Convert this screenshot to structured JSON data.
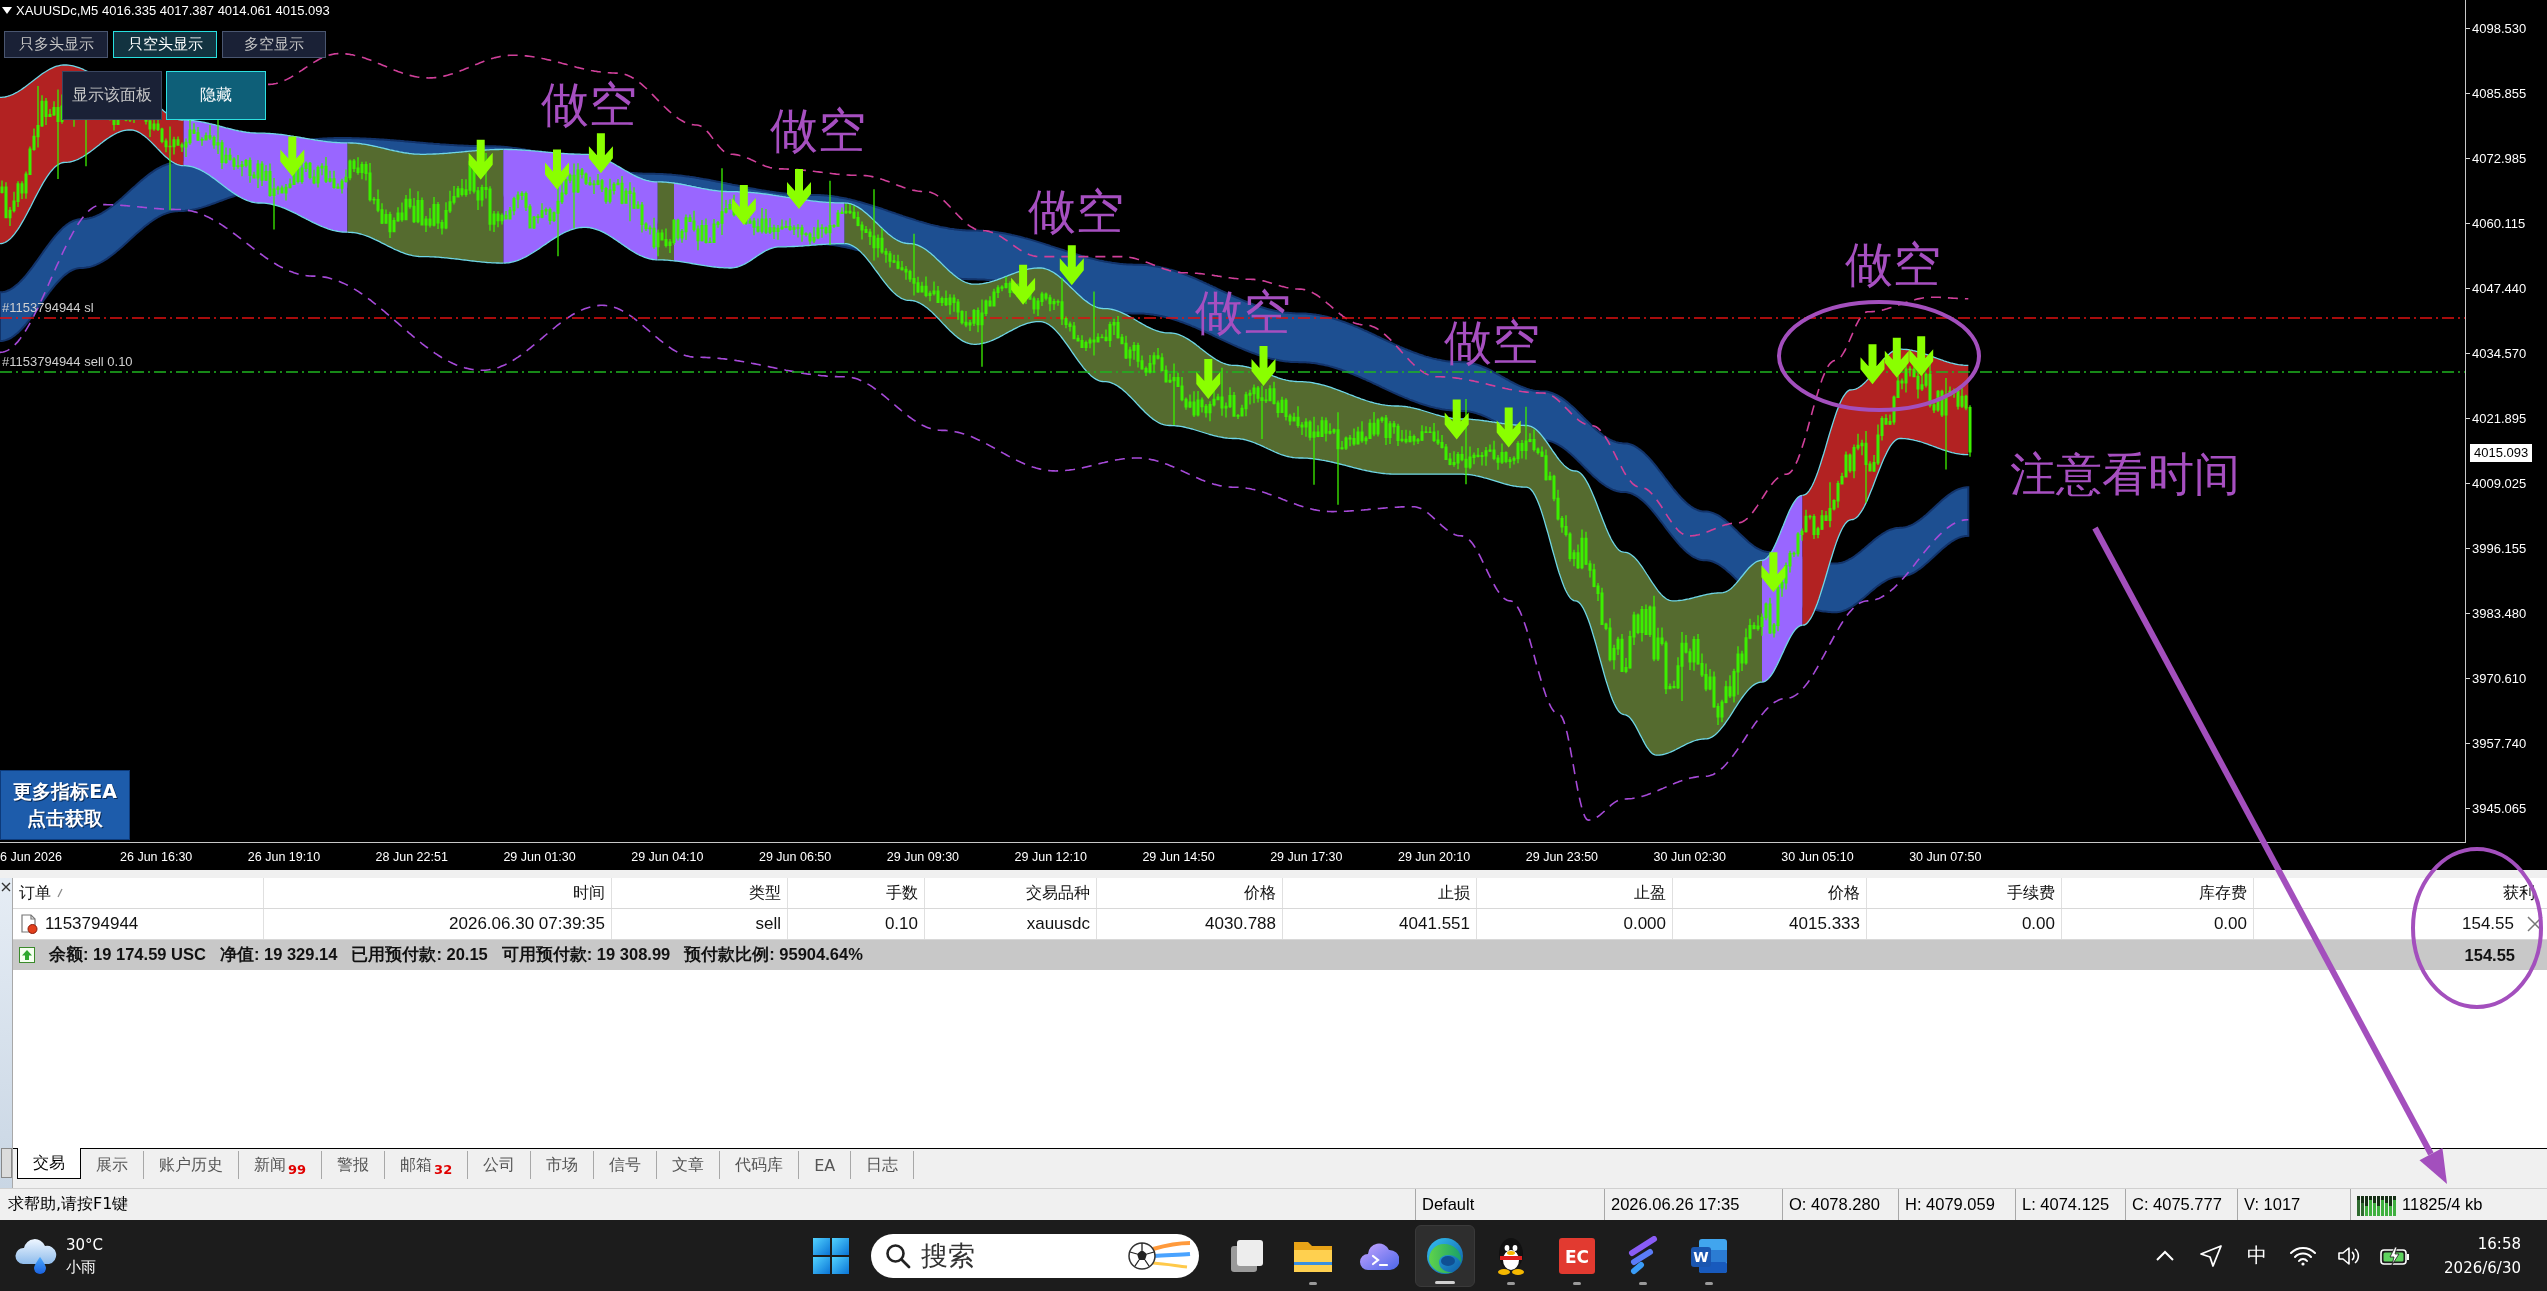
{
  "chart": {
    "title": "XAUUSDc,M5 4016.335 4017.387 4014.061 4015.093",
    "mode_buttons": [
      {
        "label": "只多头显示",
        "selected": false
      },
      {
        "label": "只空头显示",
        "selected": true
      },
      {
        "label": "多空显示",
        "selected": false
      }
    ],
    "panel_buttons": [
      {
        "label": "显示该面板",
        "selected": false
      },
      {
        "label": "隐藏",
        "selected": true
      }
    ],
    "trade_lines": [
      {
        "kind": "stop_loss",
        "label": "#1153794944 sl"
      },
      {
        "kind": "order",
        "label": "#1153794944 sell 0.10"
      }
    ],
    "signal_labels": [
      "做空",
      "做空",
      "做空",
      "做空",
      "做空",
      "做空"
    ],
    "note": "注意看时间",
    "promo_button": {
      "lines": [
        "更多指标EA",
        "点击获取"
      ]
    },
    "price_axis": {
      "labels": [
        "4098.530",
        "4085.855",
        "4072.985",
        "4060.115",
        "4047.440",
        "4034.570",
        "4021.895",
        "4009.025",
        "3996.155",
        "3983.480",
        "3970.610",
        "3957.740",
        "3945.065"
      ],
      "current_price": "4015.093"
    },
    "time_axis": {
      "labels": [
        "6 Jun 2026",
        "26 Jun 16:30",
        "26 Jun 19:10",
        "28 Jun 22:51",
        "29 Jun 01:30",
        "29 Jun 04:10",
        "29 Jun 06:50",
        "29 Jun 09:30",
        "29 Jun 12:10",
        "29 Jun 14:50",
        "29 Jun 17:30",
        "29 Jun 20:10",
        "29 Jun 23:50",
        "30 Jun 02:30",
        "30 Jun 05:10",
        "30 Jun 07:50"
      ]
    }
  },
  "terminal": {
    "columns": [
      {
        "label": "订单",
        "sorted": true
      },
      {
        "label": "时间",
        "sorted": false
      },
      {
        "label": "类型",
        "sorted": false
      },
      {
        "label": "手数",
        "sorted": false
      },
      {
        "label": "交易品种",
        "sorted": false
      },
      {
        "label": "价格",
        "sorted": false
      },
      {
        "label": "止损",
        "sorted": false
      },
      {
        "label": "止盈",
        "sorted": false
      },
      {
        "label": "价格",
        "sorted": false
      },
      {
        "label": "手续费",
        "sorted": false
      },
      {
        "label": "库存费",
        "sorted": false
      },
      {
        "label": "获利",
        "sorted": false
      }
    ],
    "rows": [
      {
        "cells": [
          "1153794944",
          "2026.06.30 07:39:35",
          "sell",
          "0.10",
          "xauusdc",
          "4030.788",
          "4041.551",
          "0.000",
          "4015.333",
          "0.00",
          "0.00",
          "154.55"
        ]
      }
    ],
    "summary": {
      "items": [
        "余额: 19 174.59 USC",
        "净值: 19 329.14",
        "已用预付款: 20.15",
        "可用预付款: 19 308.99",
        "预付款比例: 95904.64%"
      ],
      "profit": "154.55"
    },
    "tabs": [
      {
        "label": "交易",
        "selected": true
      },
      {
        "label": "展示",
        "selected": false
      },
      {
        "label": "账户历史",
        "selected": false
      },
      {
        "label": "新闻",
        "badge": "99",
        "selected": false
      },
      {
        "label": "警报",
        "selected": false
      },
      {
        "label": "邮箱",
        "badge": "32",
        "selected": false
      },
      {
        "label": "公司",
        "selected": false
      },
      {
        "label": "市场",
        "selected": false
      },
      {
        "label": "信号",
        "selected": false
      },
      {
        "label": "文章",
        "selected": false
      },
      {
        "label": "代码库",
        "selected": false
      },
      {
        "label": "EA",
        "selected": false
      },
      {
        "label": "日志",
        "selected": false
      }
    ]
  },
  "status_bar": {
    "help": "求帮助,请按F1键",
    "fields": [
      "Default",
      "2026.06.26 17:35",
      "O: 4078.280",
      "H: 4079.059",
      "L: 4074.125",
      "C: 4075.777",
      "V: 1017"
    ],
    "traffic": "11825/4 kb"
  },
  "taskbar": {
    "weather": {
      "temperature": "30°C",
      "condition": "小雨"
    },
    "search": {
      "placeholder": "搜索"
    },
    "apps": [
      {
        "kind": "window",
        "running": false,
        "selected": false
      },
      {
        "kind": "folder",
        "running": true,
        "selected": false
      },
      {
        "kind": "cloud",
        "running": false,
        "selected": false
      },
      {
        "kind": "browser",
        "running": true,
        "selected": true
      },
      {
        "kind": "penguin",
        "running": true,
        "selected": false
      },
      {
        "kind": "tile",
        "text": "EC",
        "running": true,
        "selected": false
      },
      {
        "kind": "feather",
        "running": true,
        "selected": false
      },
      {
        "kind": "document",
        "text": "W",
        "running": true,
        "selected": false
      }
    ],
    "input_method": "中",
    "clock": {
      "time": "16:58",
      "date": "2026/6/30"
    }
  }
}
